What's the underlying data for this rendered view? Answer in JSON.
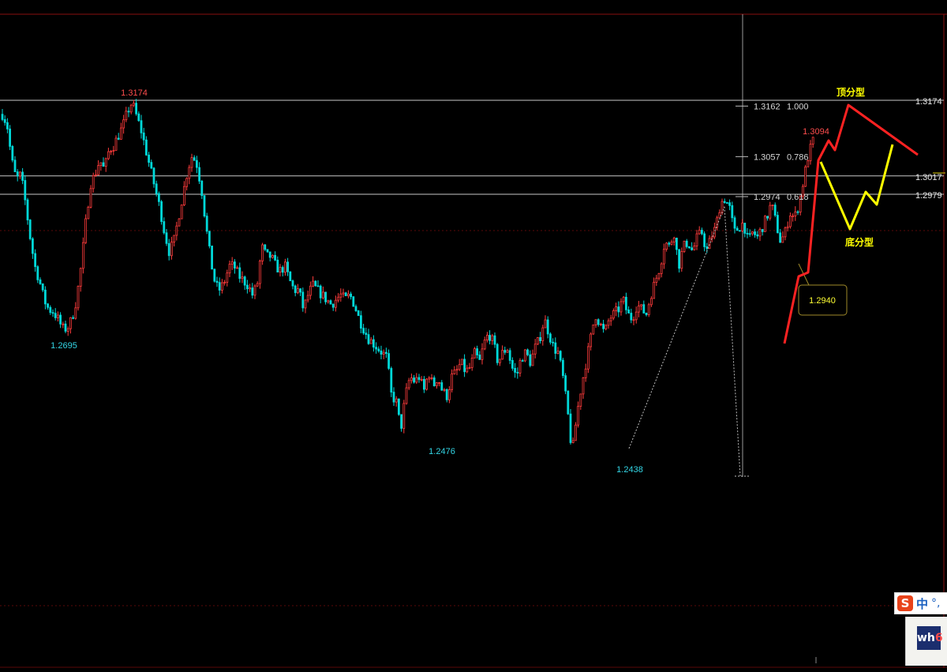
{
  "chart_data": {
    "type": "candlestick",
    "ylim": [
      1.243,
      1.321
    ],
    "grid": false,
    "price_levels": [
      {
        "label": "1.3174",
        "value": 1.3174,
        "color": "#c8c8c8"
      },
      {
        "label": "1.3017",
        "value": 1.3017,
        "color": "#c8c8c8"
      },
      {
        "label": "1.2979",
        "value": 1.2979,
        "color": "#c8c8c8"
      }
    ],
    "fibonacci": [
      {
        "price": "1.3162",
        "ratio": "1.000",
        "value": 1.3162
      },
      {
        "price": "1.3057",
        "ratio": "0.786",
        "value": 1.3057
      },
      {
        "price": "1.2974",
        "ratio": "0.618",
        "value": 1.2974
      }
    ],
    "swing_labels": [
      {
        "text": "1.3174",
        "value": 1.3174,
        "kind": "high"
      },
      {
        "text": "1.2695",
        "value": 1.2695,
        "kind": "low"
      },
      {
        "text": "1.2476",
        "value": 1.2476,
        "kind": "low"
      },
      {
        "text": "1.2438",
        "value": 1.2438,
        "kind": "low"
      },
      {
        "text": "1.3094",
        "value": 1.3094,
        "kind": "high"
      }
    ],
    "tooltip": {
      "text": "1.2940",
      "value": 1.294
    },
    "annotations": {
      "top_pattern": "顶分型",
      "bottom_pattern": "底分型"
    },
    "path_close": [
      1.3145,
      1.3125,
      1.305,
      1.301,
      1.302,
      1.296,
      1.289,
      1.283,
      1.28,
      1.276,
      1.274,
      1.2735,
      1.272,
      1.27,
      1.27,
      1.272,
      1.276,
      1.283,
      1.292,
      1.3,
      1.302,
      1.305,
      1.303,
      1.307,
      1.308,
      1.31,
      1.312,
      1.315,
      1.317,
      1.314,
      1.311,
      1.307,
      1.303,
      1.299,
      1.295,
      1.29,
      1.286,
      1.288,
      1.293,
      1.298,
      1.303,
      1.306,
      1.304,
      1.299,
      1.291,
      1.284,
      1.279,
      1.278,
      1.28,
      1.283,
      1.283,
      1.281,
      1.28,
      1.279,
      1.277,
      1.279,
      1.287,
      1.285,
      1.285,
      1.283,
      1.282,
      1.283,
      1.28,
      1.278,
      1.278,
      1.274,
      1.277,
      1.279,
      1.278,
      1.277,
      1.276,
      1.275,
      1.276,
      1.277,
      1.276,
      1.277,
      1.275,
      1.272,
      1.27,
      1.268,
      1.267,
      1.266,
      1.265,
      1.264,
      1.256,
      1.255,
      1.249,
      1.256,
      1.26,
      1.259,
      1.26,
      1.257,
      1.261,
      1.258,
      1.26,
      1.257,
      1.256,
      1.26,
      1.261,
      1.263,
      1.261,
      1.262,
      1.265,
      1.263,
      1.267,
      1.269,
      1.267,
      1.263,
      1.265,
      1.266,
      1.262,
      1.26,
      1.264,
      1.265,
      1.263,
      1.266,
      1.268,
      1.272,
      1.269,
      1.266,
      1.265,
      1.26,
      1.253,
      1.244,
      1.252,
      1.258,
      1.263,
      1.268,
      1.273,
      1.271,
      1.269,
      1.272,
      1.273,
      1.274,
      1.276,
      1.273,
      1.272,
      1.275,
      1.274,
      1.273,
      1.277,
      1.28,
      1.283,
      1.288,
      1.287,
      1.29,
      1.283,
      1.287,
      1.288,
      1.286,
      1.289,
      1.29,
      1.286,
      1.289,
      1.291,
      1.296,
      1.297,
      1.295,
      1.29,
      1.291,
      1.292,
      1.288,
      1.29,
      1.289,
      1.291,
      1.293,
      1.296,
      1.292,
      1.288,
      1.29,
      1.294,
      1.293,
      1.296,
      1.301,
      1.306,
      1.309
    ]
  }
}
